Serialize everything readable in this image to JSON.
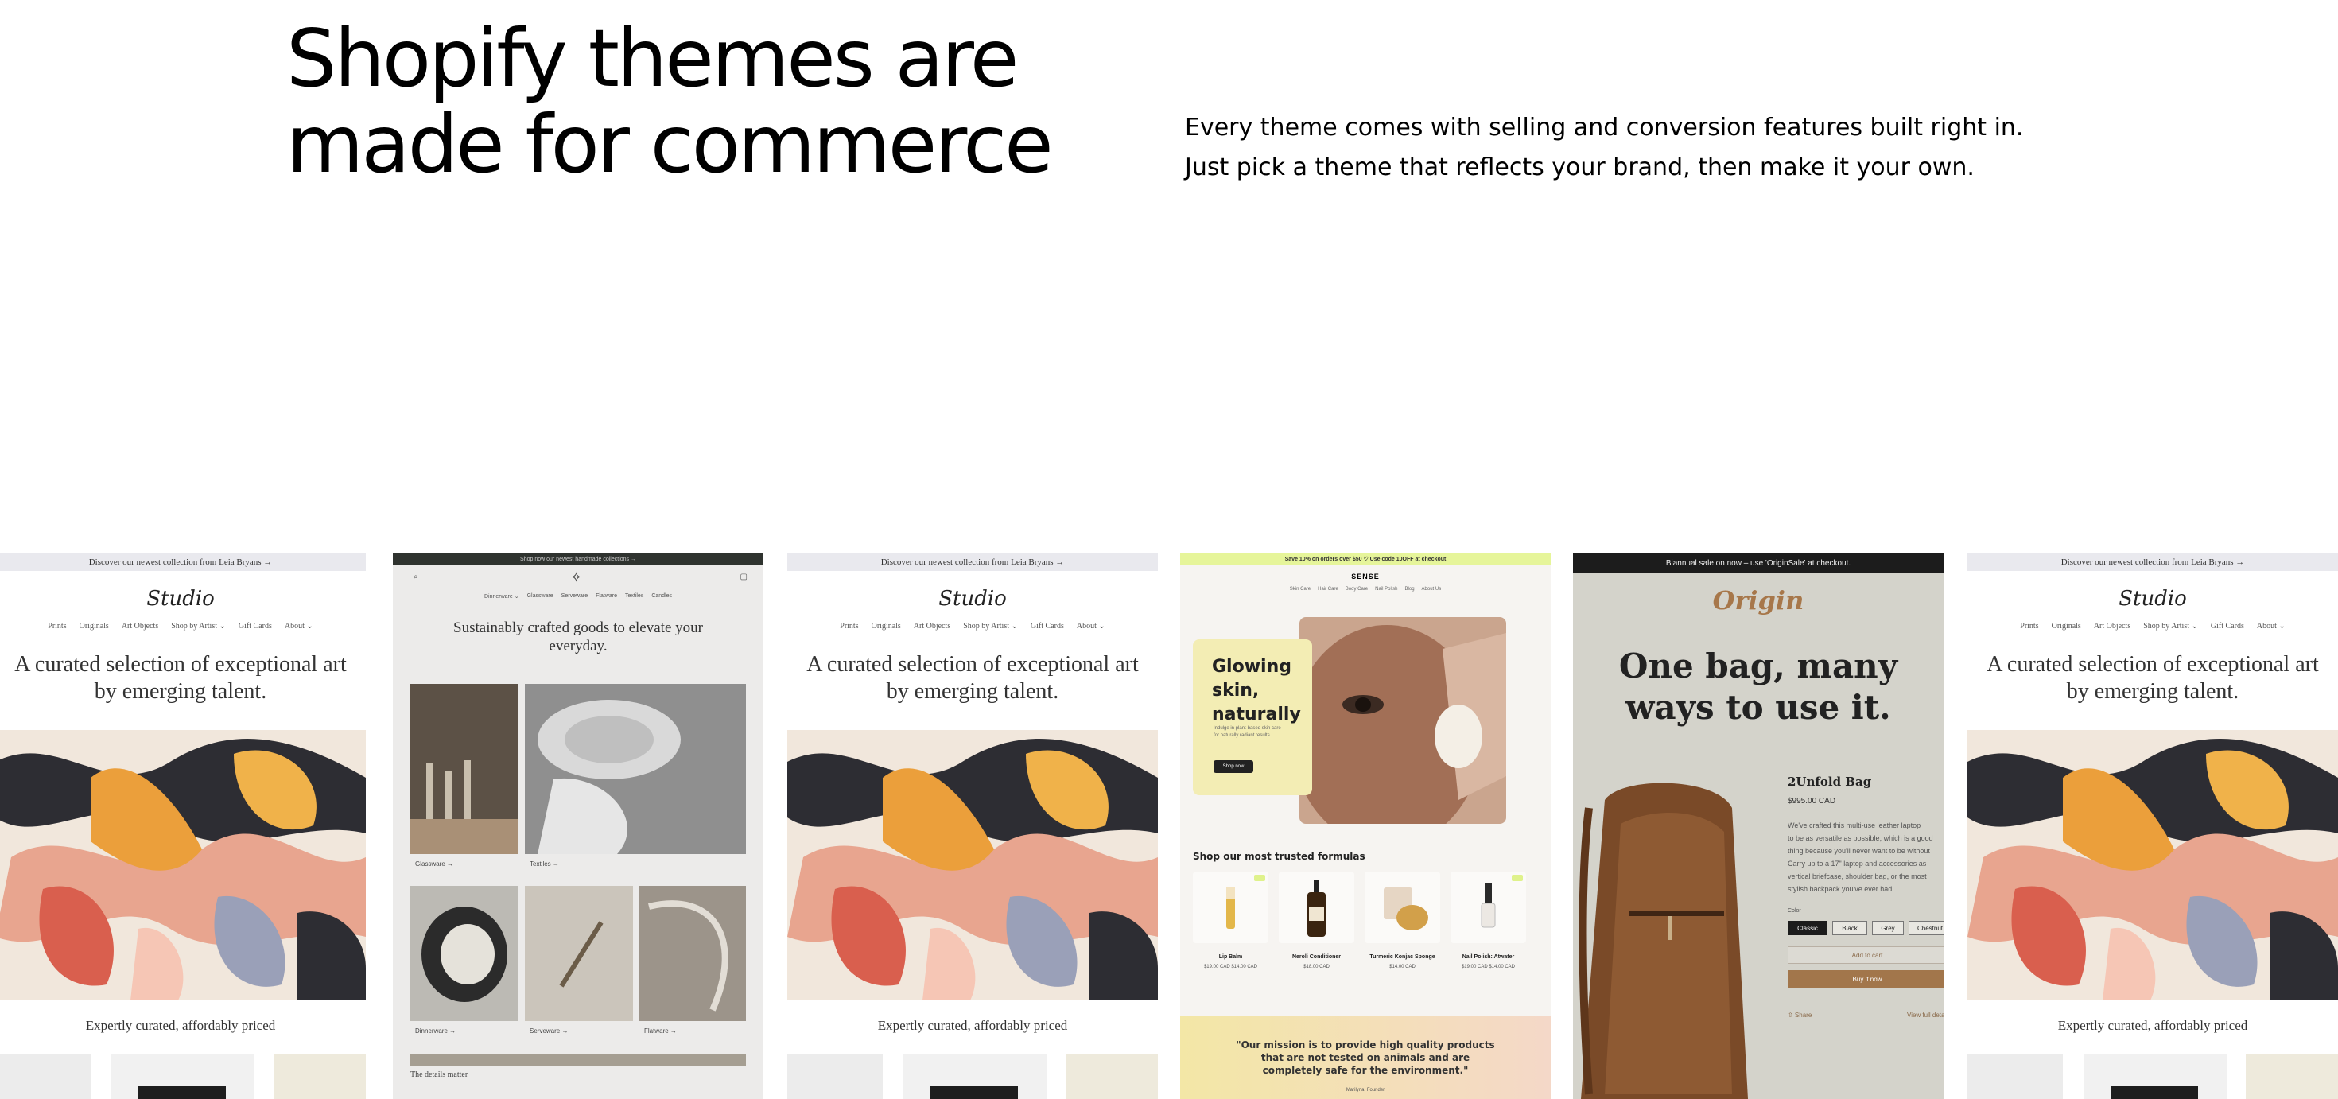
{
  "hero": {
    "headline": "Shopify themes are made for commerce",
    "subtext": "Every theme comes with selling and conversion features built right in. Just pick a theme that reflects your brand, then make it your own."
  },
  "studio": {
    "announcement": "Discover our newest collection from Leia Bryans →",
    "logo": "Studio",
    "nav": [
      "Prints",
      "Originals",
      "Art Objects",
      "Shop by Artist ⌄",
      "Gift Cards",
      "About ⌄"
    ],
    "hero": "A curated selection of exceptional art by emerging talent.",
    "subheading": "Expertly curated, affordably priced"
  },
  "crafted": {
    "announcement": "Shop now our newest handmade collections →",
    "nav": [
      "Dinnerware ⌄",
      "Glassware",
      "Serveware",
      "Flatware",
      "Textiles",
      "Candles"
    ],
    "title": "Sustainably crafted goods to elevate your everyday.",
    "labels": [
      "Glassware →",
      "Textiles →",
      "Dinnerware →",
      "Serveware →",
      "Flatware →"
    ],
    "details": "The details matter"
  },
  "sense": {
    "promo": "Save 10% on orders over $50 ♡ Use code 10OFF at checkout",
    "brand": "SENSE",
    "nav": [
      "Skin Care",
      "Hair Care",
      "Body Care",
      "Nail Polish",
      "Blog",
      "About Us"
    ],
    "glow_title": "Glowing skin, naturally",
    "glow_copy": "Indulge in plant-based skin care for naturally radiant results.",
    "shop_now": "Shop now",
    "section_heading": "Shop our most trusted formulas",
    "products": [
      {
        "name": "Lip Balm",
        "price": "$19.00 CAD $14.00 CAD",
        "sale": true
      },
      {
        "name": "Neroli Conditioner",
        "price": "$18.00 CAD",
        "sale": false
      },
      {
        "name": "Turmeric Konjac Sponge",
        "price": "$14.00 CAD",
        "sale": false
      },
      {
        "name": "Nail Polish: Atwater",
        "price": "$19.00 CAD $14.00 CAD",
        "sale": true
      }
    ],
    "quote": "\"Our mission is to provide high quality products that are not tested on animals and are completely safe for the environment.\"",
    "founder": "Marilyna, Founder"
  },
  "origin": {
    "sale_bar": "Biannual sale on now – use 'OriginSale' at checkout.",
    "logo": "Origin",
    "hero": "One bag, many ways to use it.",
    "product_name": "2Unfold Bag",
    "price": "$995.00 CAD",
    "description": [
      "We've crafted this multi-use leather laptop",
      "to be as versatile as possible, which is a good",
      "thing because you'll never want to be without",
      "Carry up to a 17\" laptop and accessories as",
      "vertical briefcase, shoulder bag, or the most",
      "stylish backpack you've ever had."
    ],
    "color_label": "Color",
    "colors": [
      "Classic",
      "Black",
      "Grey",
      "Chestnut"
    ],
    "add_to_cart": "Add to cart",
    "buy_now": "Buy it now",
    "share": "⇧ Share",
    "view_full": "View full details →"
  },
  "colors": {
    "origin_accent": "#a2764b",
    "sense_accent": "#e6f59a",
    "crafted_dark": "#2f332f"
  }
}
